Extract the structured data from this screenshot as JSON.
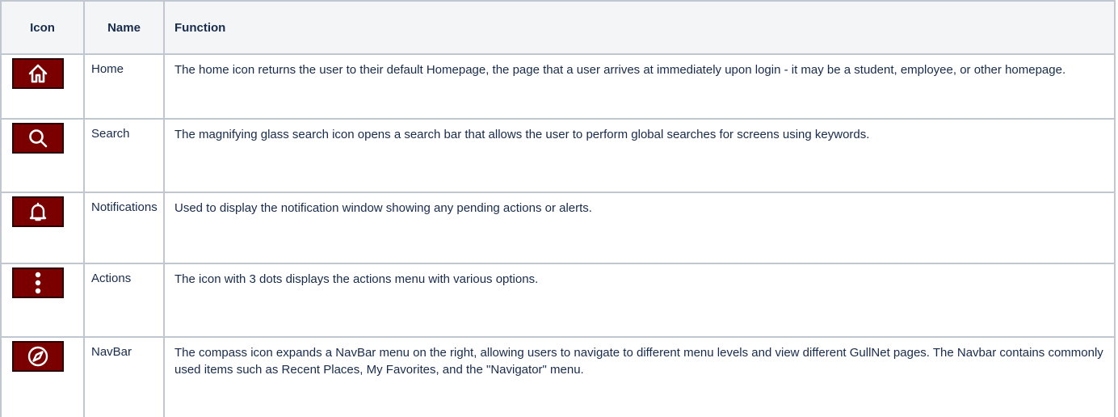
{
  "table": {
    "headers": {
      "icon": "Icon",
      "name": "Name",
      "function": "Function"
    },
    "rows": [
      {
        "icon": "home-icon",
        "name": "Home",
        "function": "The home icon returns the user to their default Homepage, the page that a user arrives at immediately upon login - it may be a student, employee, or other homepage."
      },
      {
        "icon": "search-icon",
        "name": "Search",
        "function": "The magnifying glass search icon opens a search bar that allows the user to perform global searches for screens using keywords."
      },
      {
        "icon": "bell-icon",
        "name": "Notifications",
        "function": "Used to display the notification window showing any pending actions or alerts."
      },
      {
        "icon": "more-vertical-icon",
        "name": "Actions",
        "function": "The icon with 3 dots displays the actions menu with various options."
      },
      {
        "icon": "compass-icon",
        "name": "NavBar",
        "function": "The compass icon expands a NavBar menu on the right, allowing users to navigate to different menu levels and view different GullNet pages.  The Navbar contains commonly used items such as Recent Places, My Favorites, and the \"Navigator\" menu."
      }
    ]
  },
  "colors": {
    "icon_background": "#7a0000",
    "icon_border": "#2b0000",
    "icon_glyph": "#ffffff",
    "header_background": "#f4f5f7",
    "grid_border": "#c1c7d0",
    "text": "#172b4d"
  }
}
